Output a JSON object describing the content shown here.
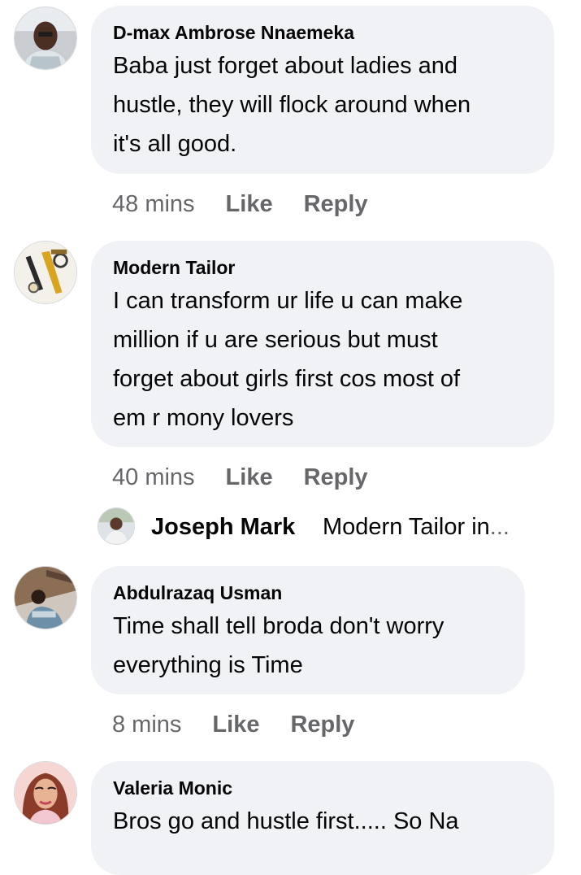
{
  "comments": [
    {
      "author": "D-max Ambrose Nnaemeka",
      "lines": [
        "Baba just forget about ladies and",
        "hustle, they will flock around when",
        "it's all good."
      ],
      "time": "48 mins",
      "like_label": "Like",
      "reply_label": "Reply"
    },
    {
      "author": "Modern Tailor",
      "lines": [
        "I can transform ur life u can make",
        "million if u are serious but must",
        "forget about girls first cos most of",
        "em r mony lovers"
      ],
      "time": "40 mins",
      "like_label": "Like",
      "reply_label": "Reply"
    },
    {
      "author": "Abdulrazaq Usman",
      "lines": [
        "Time shall tell broda don't worry",
        "everything is Time"
      ],
      "time": "8 mins",
      "like_label": "Like",
      "reply_label": "Reply"
    },
    {
      "author": "Valeria Monic",
      "lines": [
        "Bros go and hustle first..... So Na"
      ]
    }
  ],
  "reply_preview": {
    "author": "Joseph Mark",
    "text": "Modern Tailor in",
    "ellipsis": "..."
  },
  "colors": {
    "bubble": "#f0f2f5",
    "text": "#050505",
    "secondary": "#65676b"
  }
}
